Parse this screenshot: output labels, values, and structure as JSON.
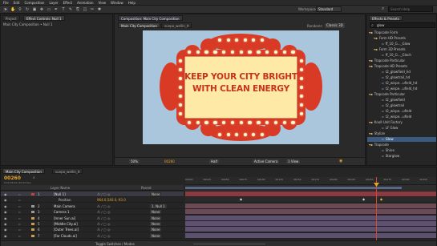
{
  "menubar": [
    "File",
    "Edit",
    "Composition",
    "Layer",
    "Effect",
    "Animation",
    "View",
    "Window",
    "Help"
  ],
  "tool_icons": [
    "selection-tool",
    "hand-tool",
    "zoom-tool",
    "rotate-tool",
    "camera-tool",
    "pan-behind-tool",
    "rectangle-tool",
    "pen-tool",
    "type-tool",
    "brush-tool",
    "clone-tool",
    "eraser-tool",
    "roto-tool",
    "puppet-tool"
  ],
  "workspace": {
    "label": "Workspace:",
    "value": "Standard"
  },
  "search": {
    "placeholder": "Search Help"
  },
  "left_panel": {
    "tabs": [
      "Project",
      "Effect Controls: Null 1"
    ],
    "subtitle": "Main City Composition • Null 1"
  },
  "viewer": {
    "tabs": [
      "Composition: Main City Composition"
    ],
    "subtabs": [
      "Main City Composition",
      "sunpo_wellin_lt"
    ],
    "renderer_label": "Renderer:",
    "renderer": "Classic 3D",
    "sign_line1": "KEEP YOUR CITY BRIGHT",
    "sign_line2": "WITH CLEAN ENERGY",
    "zoom": "50%",
    "timecode": "00260",
    "quality": "Half",
    "camera": "Active Camera",
    "views": "1 View"
  },
  "right_panel": {
    "title": "Effects & Presets",
    "search": "glow",
    "items": [
      {
        "label": "Trapcode Form",
        "type": "folder"
      },
      {
        "label": "Form HD Presets",
        "type": "folder"
      },
      {
        "label": "ff_10_G..._Glow",
        "type": "file"
      },
      {
        "label": "Form 3D Presets",
        "type": "folder"
      },
      {
        "label": "ff_10_G..._Gloch",
        "type": "file"
      },
      {
        "label": "Trapcode Particular",
        "type": "folder"
      },
      {
        "label": "Trapcode HD Presets",
        "type": "folder"
      },
      {
        "label": "t2_glowfield_hd",
        "type": "file"
      },
      {
        "label": "t2_glowtrail_hd",
        "type": "file"
      },
      {
        "label": "t2_wispe...ufield_hd",
        "type": "file"
      },
      {
        "label": "t2_wispe...ufield_hd",
        "type": "file"
      },
      {
        "label": "Trapcode Particular",
        "type": "folder"
      },
      {
        "label": "t2_glowfield",
        "type": "file"
      },
      {
        "label": "t2_glowtrail",
        "type": "file"
      },
      {
        "label": "t2_wispe...ufield",
        "type": "file"
      },
      {
        "label": "t2_wispe...ufield",
        "type": "file"
      },
      {
        "label": "Knoll Unit Factory",
        "type": "folder"
      },
      {
        "label": "LF Glow",
        "type": "file"
      },
      {
        "label": "Stylize",
        "type": "folder"
      },
      {
        "label": "Glow",
        "type": "file",
        "selected": true
      },
      {
        "label": "Trapcode",
        "type": "folder"
      },
      {
        "label": "Shine",
        "type": "file"
      },
      {
        "label": "Starglow",
        "type": "file"
      }
    ]
  },
  "timeline": {
    "tabs": [
      "Main City Composition",
      "sunpo_wellin_lt"
    ],
    "timecode": "00260",
    "fps": "0:00:08:20 (30.00 fps)",
    "columns": {
      "layer_name": "Layer Name",
      "parent": "Parent"
    },
    "ticks": [
      "00000",
      "00025",
      "00050",
      "00075",
      "00100",
      "00125",
      "00150",
      "00175",
      "00200",
      "00225",
      "00250",
      "00275",
      "00300",
      "00325"
    ],
    "footer": "Toggle Switches / Modes",
    "layers": [
      {
        "num": "1",
        "name": "[Null 1]",
        "parent": "None",
        "color": "#c8403c",
        "selected": true
      },
      {
        "num": "",
        "name": "Position",
        "parent": "",
        "color": "",
        "value": "964.0,540.0,-93.0",
        "property": true
      },
      {
        "num": "2",
        "name": "Main Camera",
        "parent": "1. Null 1",
        "color": "#9a9a9a"
      },
      {
        "num": "3",
        "name": "Camera 1",
        "parent": "None",
        "color": "#9a9a9a"
      },
      {
        "num": "4",
        "name": "[Inner Sun.ai]",
        "parent": "None",
        "color": "#c8a050"
      },
      {
        "num": "5",
        "name": "[Middle City.ai]",
        "parent": "None",
        "color": "#c8a050"
      },
      {
        "num": "6",
        "name": "[Outer Trees.ai]",
        "parent": "None",
        "color": "#c8a050"
      },
      {
        "num": "7",
        "name": "[Far Clouds.ai]",
        "parent": "None",
        "color": "#c8a050"
      }
    ]
  },
  "colors": {
    "accent": "#e8a428",
    "selection": "#3c5a80",
    "sign_red": "#d83a25",
    "sign_text": "#c8331c",
    "sign_bg": "#ffe8a0",
    "sky": "#a9c6dc"
  }
}
